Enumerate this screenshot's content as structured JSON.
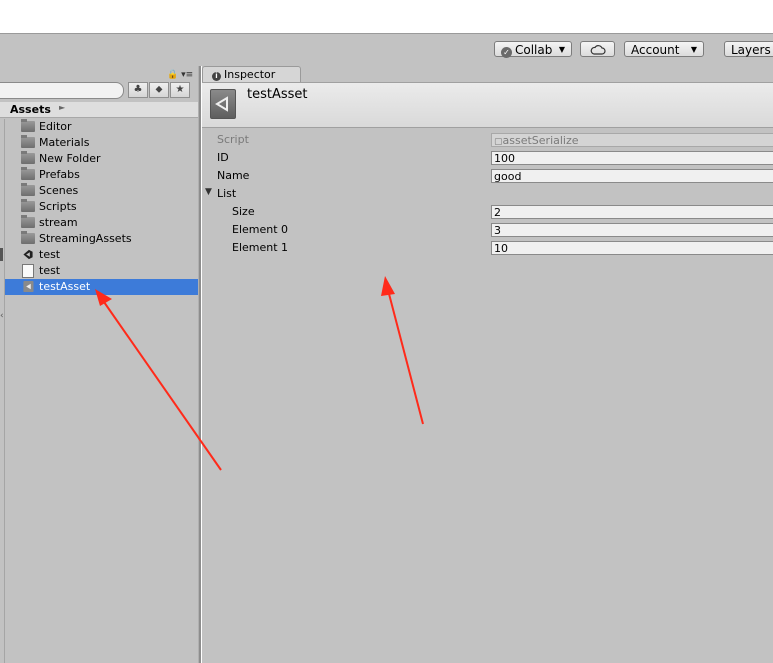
{
  "toolbar": {
    "collab_label": "Collab",
    "account_label": "Account",
    "layers_label": "Layers"
  },
  "project": {
    "breadcrumb": "Assets",
    "items": [
      {
        "label": "Editor",
        "icon": "folder-icon"
      },
      {
        "label": "Materials",
        "icon": "folder-icon"
      },
      {
        "label": "New Folder",
        "icon": "folder-icon"
      },
      {
        "label": "Prefabs",
        "icon": "folder-icon"
      },
      {
        "label": "Scenes",
        "icon": "folder-icon"
      },
      {
        "label": "Scripts",
        "icon": "folder-icon"
      },
      {
        "label": "stream",
        "icon": "folder-icon"
      },
      {
        "label": "StreamingAssets",
        "icon": "folder-icon"
      },
      {
        "label": "test",
        "icon": "unity-scene-icon"
      },
      {
        "label": "test",
        "icon": "script-file-icon"
      },
      {
        "label": "testAsset",
        "icon": "scriptable-object-icon",
        "selected": true
      }
    ]
  },
  "inspector": {
    "tab_label": "Inspector",
    "asset_name": "testAsset",
    "properties": {
      "script_label": "Script",
      "script_value": "assetSerialize",
      "id_label": "ID",
      "id_value": "100",
      "name_label": "Name",
      "name_value": "good",
      "list_label": "List",
      "size_label": "Size",
      "size_value": "2",
      "element0_label": "Element 0",
      "element0_value": "3",
      "element1_label": "Element 1",
      "element1_value": "10"
    }
  },
  "colors": {
    "selection": "#3d7bd9",
    "annotation_arrow": "#ff2a1a",
    "panel_bg": "#c2c2c2"
  }
}
